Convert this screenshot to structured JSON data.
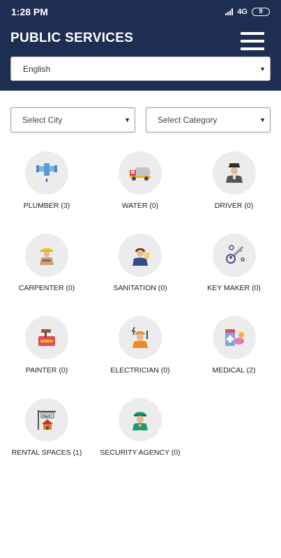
{
  "status_bar": {
    "time": "1:28 PM",
    "network": "4G",
    "battery": "9"
  },
  "header": {
    "title": "PUBLIC SERVICES"
  },
  "language_select": {
    "value": "English"
  },
  "filters": {
    "city": "Select City",
    "category": "Select Category"
  },
  "services": [
    {
      "label": "PLUMBER (3)",
      "icon": "plumber-icon"
    },
    {
      "label": "WATER (0)",
      "icon": "water-truck-icon"
    },
    {
      "label": "DRIVER (0)",
      "icon": "driver-icon"
    },
    {
      "label": "CARPENTER (0)",
      "icon": "carpenter-icon"
    },
    {
      "label": "SANITATION (0)",
      "icon": "sanitation-icon"
    },
    {
      "label": "KEY MAKER (0)",
      "icon": "key-maker-icon"
    },
    {
      "label": "PAINTER (0)",
      "icon": "painter-icon"
    },
    {
      "label": "ELECTRICIAN (0)",
      "icon": "electrician-icon"
    },
    {
      "label": "MEDICAL (2)",
      "icon": "medical-icon"
    },
    {
      "label": "RENTAL SPACES (1)",
      "icon": "rental-spaces-icon"
    },
    {
      "label": "SECURITY AGENCY (0)",
      "icon": "security-agency-icon"
    }
  ],
  "rental_sign_text": "RENT"
}
